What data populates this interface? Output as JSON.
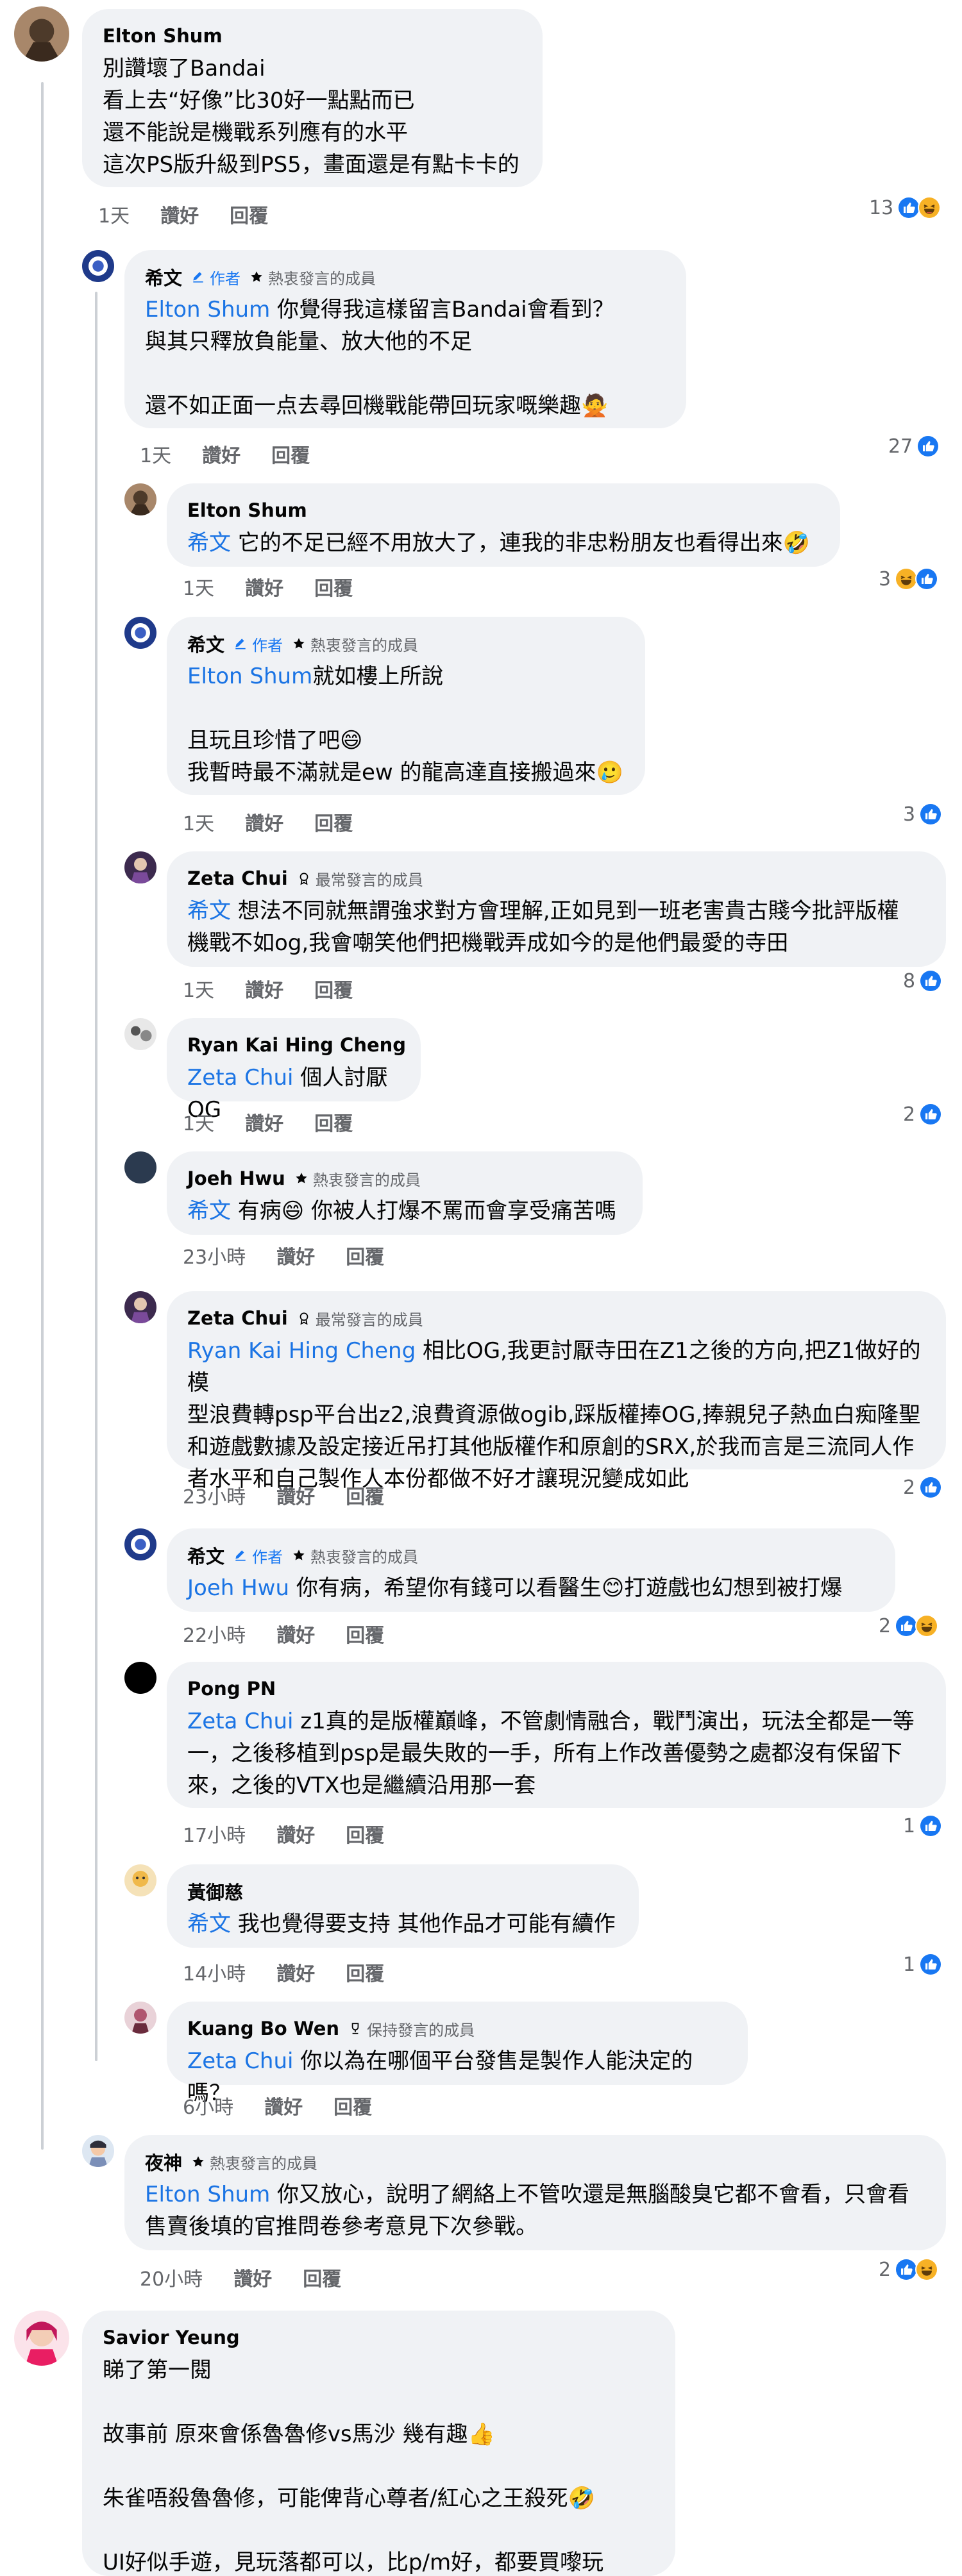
{
  "labels": {
    "like": "讚好",
    "reply": "回覆",
    "author": "作者"
  },
  "colors": {
    "link": "#1b74e4",
    "like_blue": "#1877f2",
    "haha_yellow": "#f7b125",
    "bubble_bg": "#f0f2f5",
    "meta_gray": "#65676b"
  },
  "comments": [
    {
      "name": "Elton Shum",
      "badges": [],
      "lines": [
        "別讚壞了Bandai",
        "看上去“好像”比30好一點點而已",
        "還不能說是機戰系列應有的水平",
        "這次PS版升級到PS5，畫面還是有點卡卡的"
      ],
      "mention": "",
      "time": "1天",
      "reaction_count": "13",
      "reactions": [
        "like-icon",
        "haha-icon"
      ]
    },
    {
      "name": "希文",
      "badges": [
        "作者",
        "熱衷發言的成員"
      ],
      "mention": "Elton Shum",
      "lines": [
        " 你覺得我這樣留言Bandai會看到？",
        "與其只釋放負能量、放大他的不足",
        "",
        "還不如正面一点去尋回機戰能帶回玩家嘅樂趣🙅"
      ],
      "time": "1天",
      "reaction_count": "27",
      "reactions": [
        "like-icon"
      ]
    },
    {
      "name": "Elton Shum",
      "badges": [],
      "mention": "希文",
      "lines": [
        " 它的不足已經不用放大了，連我的非忠粉朋友也看得出來🤣"
      ],
      "time": "1天",
      "reaction_count": "3",
      "reactions": [
        "haha-icon",
        "like-icon"
      ]
    },
    {
      "name": "希文",
      "badges": [
        "作者",
        "熱衷發言的成員"
      ],
      "mention": "Elton Shum",
      "lines": [
        "就如樓上所說",
        "",
        "且玩且珍惜了吧😄",
        "我暫時最不滿就是ew 的龍高達直接搬過來🥲"
      ],
      "time": "1天",
      "reaction_count": "3",
      "reactions": [
        "like-icon"
      ]
    },
    {
      "name": "Zeta Chui",
      "badges": [
        "最常發言的成員"
      ],
      "mention": "希文",
      "lines": [
        " 想法不同就無謂強求對方會理解,正如見到一班老害貴古賤今批評版權",
        "機戰不如og,我會嘲笑他們把機戰弄成如今的是他們最愛的寺田"
      ],
      "time": "1天",
      "reaction_count": "8",
      "reactions": [
        "like-icon"
      ]
    },
    {
      "name": "Ryan Kai Hing Cheng",
      "badges": [],
      "mention": "Zeta Chui",
      "lines": [
        " 個人討厭OG"
      ],
      "time": "1天",
      "reaction_count": "2",
      "reactions": [
        "like-icon"
      ]
    },
    {
      "name": "Joeh Hwu",
      "badges": [
        "熱衷發言的成員"
      ],
      "mention": "希文",
      "lines": [
        " 有病😄 你被人打爆不罵而會享受痛苦嗎"
      ],
      "time": "23小時",
      "reaction_count": "",
      "reactions": []
    },
    {
      "name": "Zeta Chui",
      "badges": [
        "最常發言的成員"
      ],
      "mention": "Ryan Kai Hing Cheng",
      "lines": [
        " 相比OG,我更討厭寺田在Z1之後的方向,把Z1做好的模",
        "型浪費轉psp平台出z2,浪費資源做ogib,踩版權捧OG,捧親兒子熱血白痴隆聖",
        "和遊戲數據及設定接近吊打其他版權作和原創的SRX,於我而言是三流同人作",
        "者水平和自己製作人本份都做不好才讓現況變成如此"
      ],
      "time": "23小時",
      "reaction_count": "2",
      "reactions": [
        "like-icon"
      ]
    },
    {
      "name": "希文",
      "badges": [
        "作者",
        "熱衷發言的成員"
      ],
      "mention": "Joeh Hwu",
      "lines": [
        " 你有病，希望你有錢可以看醫生😊打遊戲也幻想到被打爆"
      ],
      "time": "22小時",
      "reaction_count": "2",
      "reactions": [
        "like-icon",
        "haha-icon"
      ]
    },
    {
      "name": "Pong PN",
      "badges": [],
      "mention": "Zeta Chui",
      "lines": [
        " z1真的是版權巔峰，不管劇情融合，戰鬥演出，玩法全都是一等",
        "一，之後移植到psp是最失敗的一手，所有上作改善優勢之處都沒有保留下",
        "來，之後的VTX也是繼續沿用那一套"
      ],
      "time": "17小時",
      "reaction_count": "1",
      "reactions": [
        "like-icon"
      ]
    },
    {
      "name": "黃御慈",
      "badges": [],
      "mention": "希文",
      "lines": [
        " 我也覺得要支持 其他作品才可能有續作"
      ],
      "time": "14小時",
      "reaction_count": "1",
      "reactions": [
        "like-icon"
      ]
    },
    {
      "name": "Kuang Bo Wen",
      "badges": [
        "保持發言的成員"
      ],
      "mention": "Zeta Chui",
      "lines": [
        " 你以為在哪個平台發售是製作人能決定的嗎？"
      ],
      "time": "6小時",
      "reaction_count": "",
      "reactions": []
    },
    {
      "name": "夜神",
      "badges": [
        "熱衷發言的成員"
      ],
      "mention": "Elton Shum",
      "lines": [
        " 你又放心，說明了網絡上不管吹還是無腦酸臭它都不會看，只會看",
        "售賣後填的官推問卷參考意見下次參戰。"
      ],
      "time": "20小時",
      "reaction_count": "2",
      "reactions": [
        "like-icon",
        "haha-icon"
      ]
    },
    {
      "name": "Savior Yeung",
      "badges": [],
      "mention": "",
      "lines": [
        "睇了第一閱",
        "",
        "故事前 原來會係魯魯修vs馬沙 幾有趣👍",
        "",
        "朱雀唔殺魯魯修，可能俾背心尊者/紅心之王殺死🤣",
        "",
        "UI好似手遊，見玩落都可以，比p/m好，都要買嚟玩"
      ],
      "time": "",
      "reaction_count": "",
      "reactions": []
    }
  ]
}
